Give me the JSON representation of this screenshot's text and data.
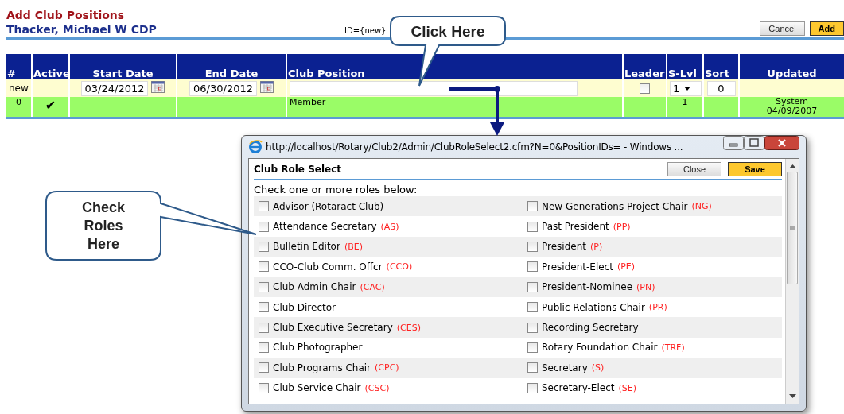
{
  "page": {
    "title": "Add Club Positions",
    "member": "Thacker, Michael W CDP",
    "record_id": "ID={new}",
    "buttons": [
      {
        "label": "Cancel",
        "kind": "secondary"
      },
      {
        "label": "Add",
        "kind": "primary"
      }
    ]
  },
  "table": {
    "columns": [
      "#",
      "Active",
      "Start Date",
      "End Date",
      "Club Position",
      "Leader",
      "S-Lvl",
      "Sort",
      "Updated"
    ],
    "new_row": {
      "number": "new",
      "start_date": "03/24/2012",
      "end_date": "06/30/2012",
      "leader": {
        "checked": false
      },
      "s_lvl": "1",
      "sort": "0"
    },
    "rows": [
      {
        "number": "0",
        "active": true,
        "active_mark": "✔",
        "start_date": "-",
        "end_date": "-",
        "club_position": "Member",
        "s_lvl": "1",
        "sort": "-",
        "updated": [
          "System",
          "04/09/2007"
        ]
      }
    ]
  },
  "popup": {
    "title": "http://localhost/Rotary/Club2/Admin/ClubRoleSelect2.cfm?N=0&PositionIDs= - Windows ...",
    "heading": "Club Role Select",
    "buttons": [
      {
        "label": "Close",
        "kind": "secondary"
      },
      {
        "label": "Save",
        "kind": "primary"
      }
    ],
    "instruction": "Check one or more roles below:",
    "roles": [
      {
        "name": "Advisor (Rotaract Club)",
        "checked": false
      },
      {
        "name": "Attendance Secretary",
        "code": "(AS)",
        "checked": false
      },
      {
        "name": "Bulletin Editor",
        "code": "(BE)",
        "checked": false
      },
      {
        "name": "CCO-Club Comm. Offcr",
        "code": "(CCO)",
        "checked": false
      },
      {
        "name": "Club Admin Chair",
        "code": "(CAC)",
        "checked": false
      },
      {
        "name": "Club Director",
        "checked": false
      },
      {
        "name": "Club Executive Secretary",
        "code": "(CES)",
        "checked": false
      },
      {
        "name": "Club Photographer",
        "checked": false
      },
      {
        "name": "Club Programs Chair",
        "code": "(CPC)",
        "checked": false
      },
      {
        "name": "Club Service Chair",
        "code": "(CSC)",
        "checked": false
      },
      {
        "name": "New Generations Project Chair",
        "code": "(NG)",
        "checked": false
      },
      {
        "name": "Past President",
        "code": "(PP)",
        "checked": false
      },
      {
        "name": "President",
        "code": "(P)",
        "checked": false
      },
      {
        "name": "President-Elect",
        "code": "(PE)",
        "checked": false
      },
      {
        "name": "President-Nominee",
        "code": "(PN)",
        "checked": false
      },
      {
        "name": "Public Relations Chair",
        "code": "(PR)",
        "checked": false
      },
      {
        "name": "Recording Secretary",
        "checked": false
      },
      {
        "name": "Rotary Foundation Chair",
        "code": "(TRF)",
        "checked": false
      },
      {
        "name": "Secretary",
        "code": "(S)",
        "checked": false
      },
      {
        "name": "Secretary-Elect",
        "code": "(SE)",
        "checked": false
      }
    ]
  },
  "callouts": [
    {
      "text": "Click Here"
    },
    {
      "text": "Check Roles Here"
    }
  ]
}
